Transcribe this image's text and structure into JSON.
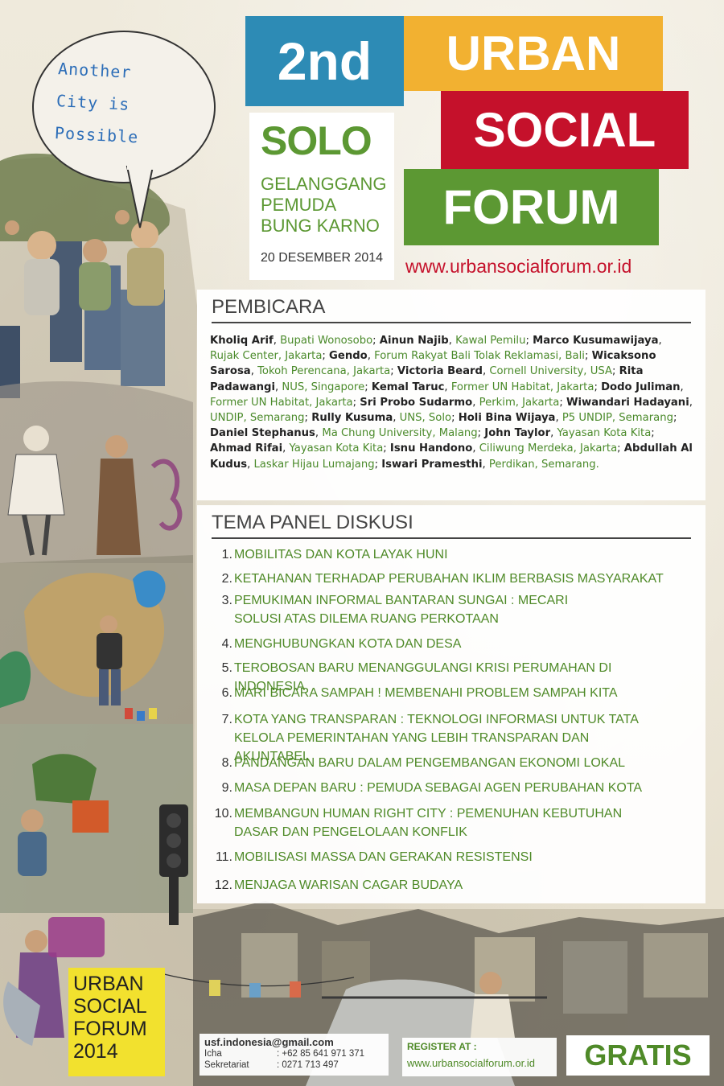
{
  "bubble": {
    "lines": [
      "Another",
      "City is",
      "Possible"
    ]
  },
  "title": {
    "edition": "2nd",
    "line1": "URBAN",
    "line2": "SOCIAL",
    "line3": "FORUM"
  },
  "event": {
    "city": "SOLO",
    "venue_lines": [
      "GELANGGANG",
      "PEMUDA",
      "BUNG KARNO"
    ],
    "date": "20 DESEMBER 2014",
    "website": "www.urbansocialforum.or.id"
  },
  "speakers": {
    "heading": "PEMBICARA",
    "list": [
      {
        "name": "Kholiq Arif",
        "affiliation": "Bupati Wonosobo"
      },
      {
        "name": "Ainun Najib",
        "affiliation": "Kawal Pemilu"
      },
      {
        "name": "Marco Kusumawijaya",
        "affiliation": "Rujak Center, Jakarta"
      },
      {
        "name": "Gendo",
        "affiliation": "Forum Rakyat Bali Tolak Reklamasi, Bali"
      },
      {
        "name": "Wicaksono Sarosa",
        "affiliation": "Tokoh Perencana, Jakarta"
      },
      {
        "name": "Victoria Beard",
        "affiliation": "Cornell University, USA"
      },
      {
        "name": "Rita Padawangi",
        "affiliation": "NUS, Singapore"
      },
      {
        "name": "Kemal Taruc",
        "affiliation": "Former UN Habitat, Jakarta"
      },
      {
        "name": "Dodo Juliman",
        "affiliation": "Former UN Habitat, Jakarta"
      },
      {
        "name": "Sri Probo Sudarmo",
        "affiliation": "Perkim, Jakarta"
      },
      {
        "name": "Wiwandari Hadayani",
        "affiliation": "UNDIP, Semarang"
      },
      {
        "name": "Rully Kusuma",
        "affiliation": "UNS, Solo"
      },
      {
        "name": "Holi Bina Wijaya",
        "affiliation": "P5 UNDIP, Semarang"
      },
      {
        "name": "Daniel Stephanus",
        "affiliation": "Ma Chung University, Malang"
      },
      {
        "name": "John Taylor",
        "affiliation": "Yayasan Kota Kita"
      },
      {
        "name": "Ahmad Rifai",
        "affiliation": "Yayasan Kota Kita"
      },
      {
        "name": "Isnu Handono",
        "affiliation": "Ciliwung Merdeka, Jakarta"
      },
      {
        "name": "Abdullah Al Kudus",
        "affiliation": "Laskar Hijau Lumajang"
      },
      {
        "name": "Iswari Pramesthi",
        "affiliation": "Perdikan, Semarang."
      }
    ]
  },
  "themes": {
    "heading": "TEMA PANEL DISKUSI",
    "items": [
      {
        "num": "1.",
        "text": "MOBILITAS DAN KOTA LAYAK HUNI"
      },
      {
        "num": "2.",
        "text": "KETAHANAN TERHADAP PERUBAHAN IKLIM BERBASIS MASYARAKAT"
      },
      {
        "num": "3.",
        "text": "PEMUKIMAN INFORMAL BANTARAN SUNGAI : MECARI SOLUSI ATAS DILEMA RUANG PERKOTAAN"
      },
      {
        "num": "4.",
        "text": "MENGHUBUNGKAN KOTA DAN DESA"
      },
      {
        "num": "5.",
        "text": "TEROBOSAN BARU MENANGGULANGI KRISI PERUMAHAN DI INDONESIA"
      },
      {
        "num": "6.",
        "text": "MARI BICARA SAMPAH ! MEMBENAHI PROBLEM SAMPAH KITA"
      },
      {
        "num": "7.",
        "text": "KOTA YANG TRANSPARAN : TEKNOLOGI INFORMASI UNTUK TATA KELOLA PEMERINTAHAN YANG LEBIH TRANSPARAN DAN AKUNTABEL"
      },
      {
        "num": "8.",
        "text": "PANDANGAN BARU DALAM PENGEMBANGAN EKONOMI LOKAL"
      },
      {
        "num": "9.",
        "text": "MASA DEPAN BARU : PEMUDA SEBAGAI AGEN PERUBAHAN KOTA"
      },
      {
        "num": "10.",
        "text": "MEMBANGUN HUMAN RIGHT CITY : PEMENUHAN KEBUTUHAN DASAR DAN PENGELOLAAN KONFLIK"
      },
      {
        "num": "11.",
        "text": "MOBILISASI MASSA DAN GERAKAN RESISTENSI"
      },
      {
        "num": "12.",
        "text": "MENJAGA WARISAN CAGAR BUDAYA"
      }
    ]
  },
  "footer": {
    "logo_lines": [
      "URBAN",
      "SOCIAL",
      "FORUM",
      "2014"
    ],
    "email": "usf.indonesia@gmail.com",
    "contacts": [
      {
        "label": "Icha",
        "value": ": +62 85 641 971 371"
      },
      {
        "label": "Sekretariat",
        "value": ": 0271 713 497"
      }
    ],
    "register_label": "REGISTER AT :",
    "register_url": "www.urbansocialforum.or.id",
    "price": "GRATIS"
  },
  "colors": {
    "blue": "#2d8bb5",
    "yellow": "#f2b131",
    "red": "#c5112b",
    "green": "#5c9833",
    "logo_yellow": "#f2e12e"
  }
}
